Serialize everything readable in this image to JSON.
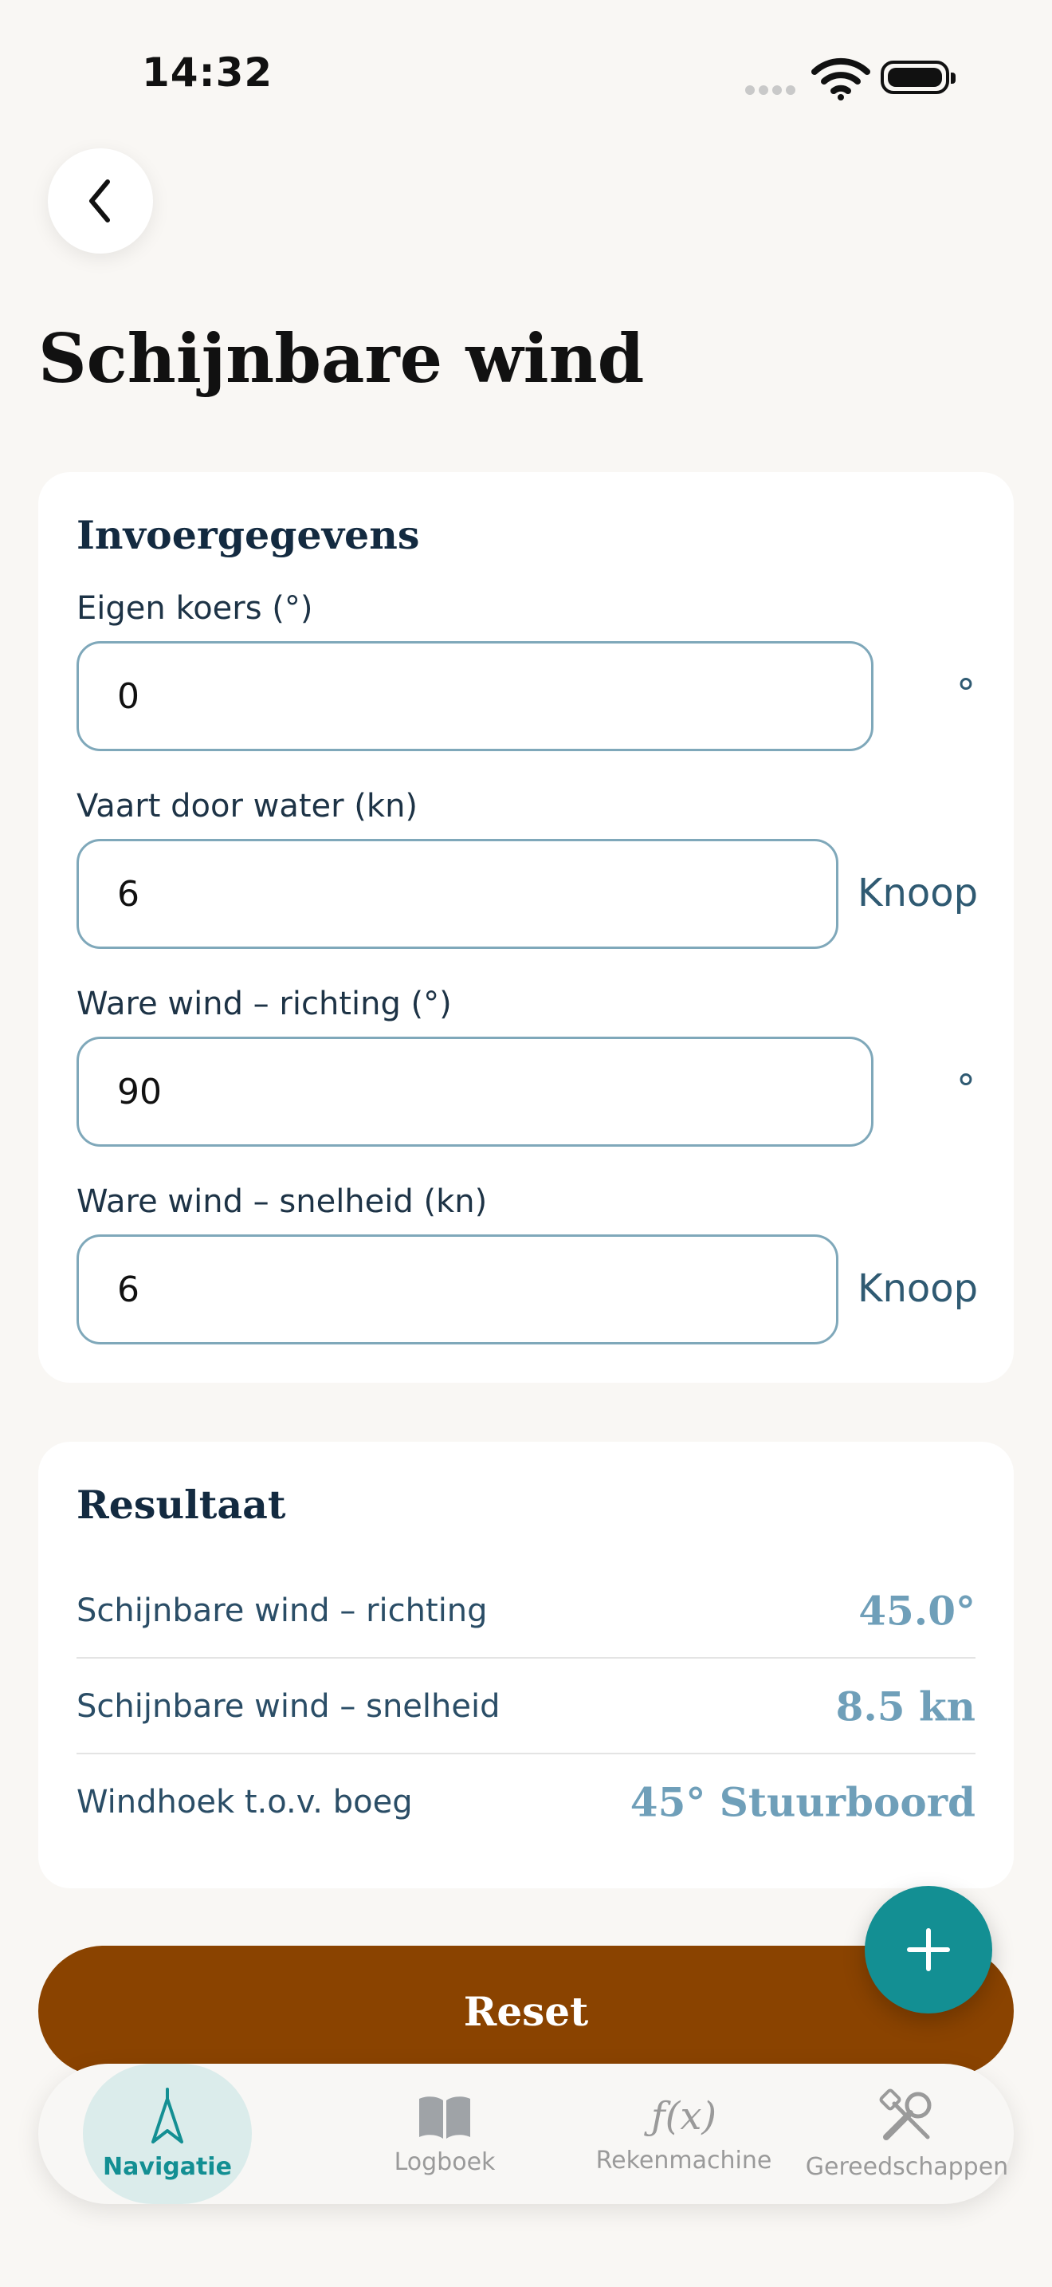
{
  "status_bar": {
    "time": "14:32"
  },
  "header": {
    "title": "Schijnbare wind"
  },
  "input_card": {
    "heading": "Invoergegevens",
    "fields": [
      {
        "label": "Eigen koers (°)",
        "value": "0",
        "unit": "°"
      },
      {
        "label": "Vaart door water (kn)",
        "value": "6",
        "unit": "Knoop"
      },
      {
        "label": "Ware wind – richting (°)",
        "value": "90",
        "unit": "°"
      },
      {
        "label": "Ware wind – snelheid (kn)",
        "value": "6",
        "unit": "Knoop"
      }
    ]
  },
  "result_card": {
    "heading": "Resultaat",
    "rows": [
      {
        "label": "Schijnbare wind – richting",
        "value": "45.0°"
      },
      {
        "label": "Schijnbare wind – snelheid",
        "value": "8.5 kn"
      },
      {
        "label": "Windhoek t.o.v. boeg",
        "value": "45° Stuurboord"
      }
    ]
  },
  "actions": {
    "reset_label": "Reset",
    "fab_icon": "plus-icon"
  },
  "bottom_nav": {
    "items": [
      {
        "label": "Navigatie",
        "icon": "navigation-arrow-icon",
        "active": true
      },
      {
        "label": "Logboek",
        "icon": "book-icon",
        "active": false
      },
      {
        "label": "Rekenmachine",
        "icon": "function-icon",
        "active": false
      },
      {
        "label": "Gereedschappen",
        "icon": "tools-icon",
        "active": false
      }
    ]
  },
  "colors": {
    "accent": "#138f93",
    "reset_button": "#8a4300",
    "result_value": "#6f9fb9",
    "background": "#f9f7f4"
  }
}
